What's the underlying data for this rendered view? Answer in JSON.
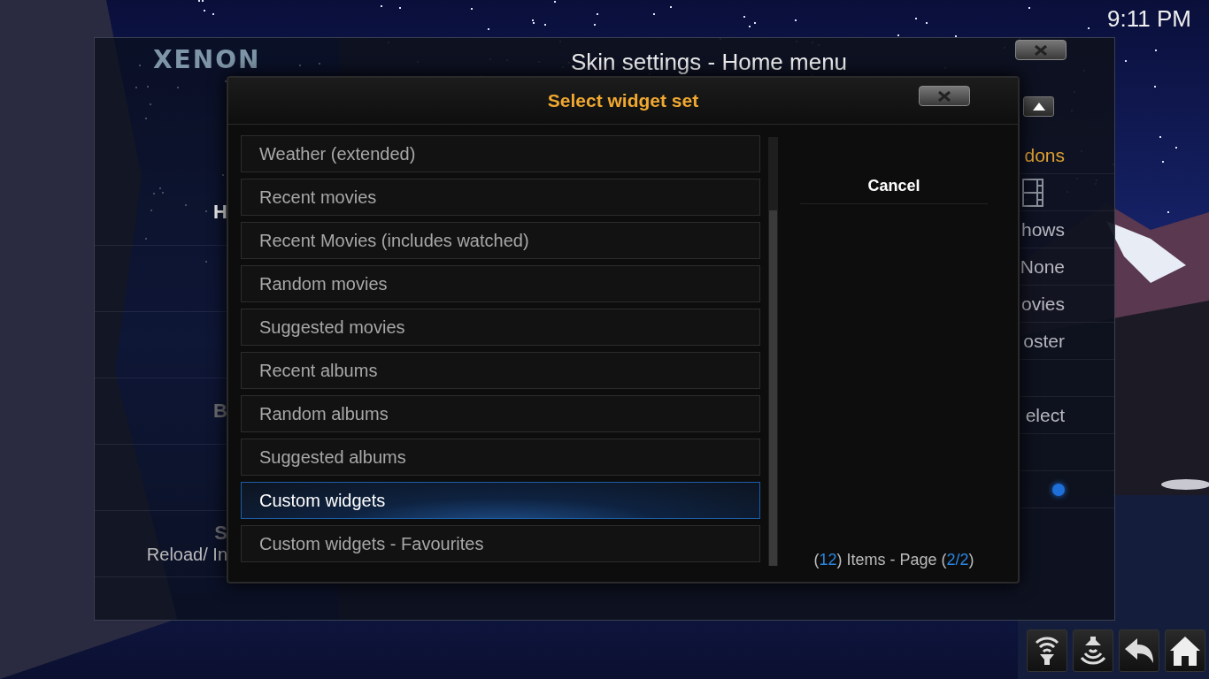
{
  "clock": "9:11 PM",
  "window": {
    "title": "Skin settings - Home menu",
    "logo": "XENON"
  },
  "sidebar": {
    "items": [
      {
        "kind": "label",
        "label": "H",
        "dim": false
      },
      {
        "kind": "blank"
      },
      {
        "kind": "blank"
      },
      {
        "kind": "label",
        "label": "B",
        "dim": true
      },
      {
        "kind": "blank"
      },
      {
        "kind": "label",
        "label": "S",
        "sublabel": "Reload/ In",
        "dim": true
      }
    ]
  },
  "settings": {
    "rows": [
      {
        "kind": "text",
        "label": "dons",
        "highlighted": true
      },
      {
        "kind": "icon"
      },
      {
        "kind": "text",
        "label": "hows",
        "highlighted": false
      },
      {
        "kind": "text",
        "label": "None",
        "highlighted": false
      },
      {
        "kind": "text",
        "label": "ovies",
        "highlighted": false
      },
      {
        "kind": "text",
        "label": "oster",
        "highlighted": false
      },
      {
        "kind": "empty"
      },
      {
        "kind": "text",
        "label": "elect",
        "highlighted": false
      },
      {
        "kind": "empty"
      },
      {
        "kind": "radio",
        "on": true
      }
    ]
  },
  "dialog": {
    "title": "Select widget set",
    "items": [
      {
        "label": "Weather (extended)",
        "selected": false
      },
      {
        "label": "Recent movies",
        "selected": false
      },
      {
        "label": "Recent Movies (includes watched)",
        "selected": false
      },
      {
        "label": "Random movies",
        "selected": false
      },
      {
        "label": "Suggested movies",
        "selected": false
      },
      {
        "label": "Recent albums",
        "selected": false
      },
      {
        "label": "Random albums",
        "selected": false
      },
      {
        "label": "Suggested albums",
        "selected": false
      },
      {
        "label": "Custom widgets",
        "selected": true
      },
      {
        "label": "Custom widgets - Favourites",
        "selected": false
      }
    ],
    "button": "Cancel",
    "footer": [
      {
        "text": "(",
        "highlight": false
      },
      {
        "text": "12",
        "highlight": true
      },
      {
        "text": ") Items - Page (",
        "highlight": false
      },
      {
        "text": "2/2",
        "highlight": true
      },
      {
        "text": ")",
        "highlight": false
      }
    ]
  }
}
